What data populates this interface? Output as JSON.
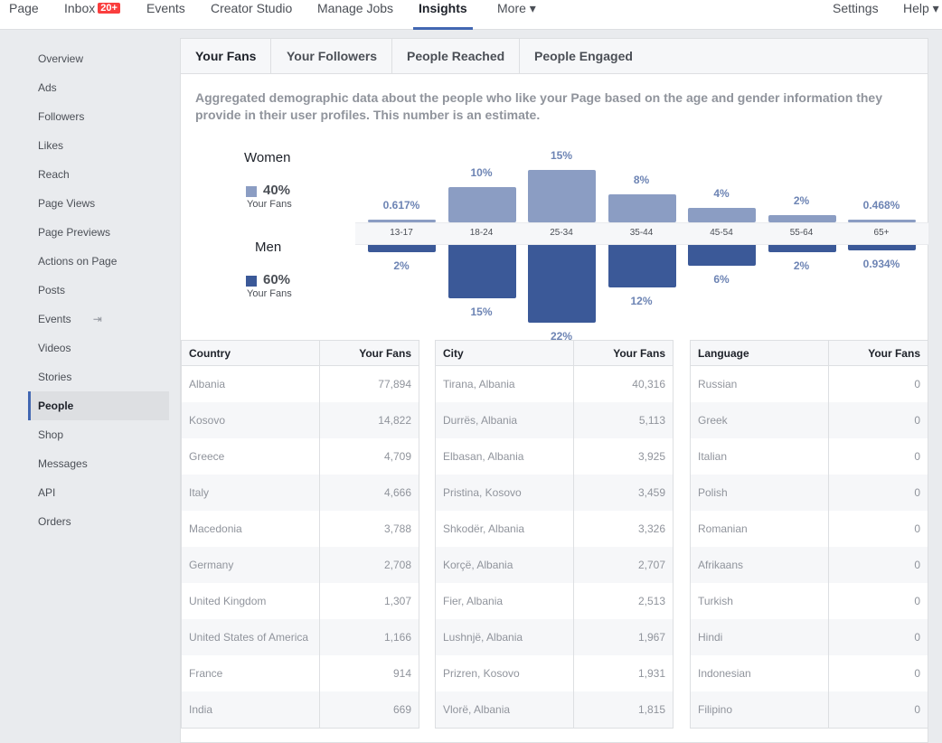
{
  "topnav": {
    "items": [
      {
        "label": "Page"
      },
      {
        "label": "Inbox",
        "badge": "20+"
      },
      {
        "label": "Events"
      },
      {
        "label": "Creator Studio"
      },
      {
        "label": "Manage Jobs"
      },
      {
        "label": "Insights",
        "active": true
      },
      {
        "label": "More ▾"
      }
    ],
    "settings": "Settings",
    "help": "Help ▾"
  },
  "sidebar": {
    "items": [
      "Overview",
      "Ads",
      "Followers",
      "Likes",
      "Reach",
      "Page Views",
      "Page Previews",
      "Actions on Page",
      "Posts",
      "Events",
      "Videos",
      "Stories",
      "People",
      "Shop",
      "Messages",
      "API",
      "Orders"
    ],
    "active": "People",
    "events_icon": "export-icon"
  },
  "tabs": [
    "Your Fans",
    "Your Followers",
    "People Reached",
    "People Engaged"
  ],
  "description": "Aggregated demographic data about the people who like your Page based on the age and gender information they provide in their user profiles. This number is an estimate.",
  "legend": {
    "women": {
      "title": "Women",
      "pct": "40%",
      "sub": "Your Fans",
      "color": "#8b9dc3"
    },
    "men": {
      "title": "Men",
      "pct": "60%",
      "sub": "Your Fans",
      "color": "#3b5998"
    }
  },
  "chart_data": {
    "type": "bar",
    "categories": [
      "13-17",
      "18-24",
      "25-34",
      "35-44",
      "45-54",
      "55-64",
      "65+"
    ],
    "series": [
      {
        "name": "Women",
        "values": [
          0.617,
          10,
          15,
          8,
          4,
          2,
          0.468
        ],
        "labels": [
          "0.617%",
          "10%",
          "15%",
          "8%",
          "4%",
          "2%",
          "0.468%"
        ]
      },
      {
        "name": "Men",
        "values": [
          2,
          15,
          22,
          12,
          6,
          2,
          0.934
        ],
        "labels": [
          "2%",
          "15%",
          "22%",
          "12%",
          "6%",
          "2%",
          "0.934%"
        ]
      }
    ]
  },
  "tables": [
    {
      "headers": [
        "Country",
        "Your Fans"
      ],
      "rows": [
        [
          "Albania",
          "77,894"
        ],
        [
          "Kosovo",
          "14,822"
        ],
        [
          "Greece",
          "4,709"
        ],
        [
          "Italy",
          "4,666"
        ],
        [
          "Macedonia",
          "3,788"
        ],
        [
          "Germany",
          "2,708"
        ],
        [
          "United Kingdom",
          "1,307"
        ],
        [
          "United States of America",
          "1,166"
        ],
        [
          "France",
          "914"
        ],
        [
          "India",
          "669"
        ]
      ]
    },
    {
      "headers": [
        "City",
        "Your Fans"
      ],
      "rows": [
        [
          "Tirana, Albania",
          "40,316"
        ],
        [
          "Durrës, Albania",
          "5,113"
        ],
        [
          "Elbasan, Albania",
          "3,925"
        ],
        [
          "Pristina, Kosovo",
          "3,459"
        ],
        [
          "Shkodër, Albania",
          "3,326"
        ],
        [
          "Korçë, Albania",
          "2,707"
        ],
        [
          "Fier, Albania",
          "2,513"
        ],
        [
          "Lushnjë, Albania",
          "1,967"
        ],
        [
          "Prizren, Kosovo",
          "1,931"
        ],
        [
          "Vlorë, Albania",
          "1,815"
        ]
      ]
    },
    {
      "headers": [
        "Language",
        "Your Fans"
      ],
      "rows": [
        [
          "Russian",
          "0"
        ],
        [
          "Greek",
          "0"
        ],
        [
          "Italian",
          "0"
        ],
        [
          "Polish",
          "0"
        ],
        [
          "Romanian",
          "0"
        ],
        [
          "Afrikaans",
          "0"
        ],
        [
          "Turkish",
          "0"
        ],
        [
          "Hindi",
          "0"
        ],
        [
          "Indonesian",
          "0"
        ],
        [
          "Filipino",
          "0"
        ]
      ]
    }
  ]
}
